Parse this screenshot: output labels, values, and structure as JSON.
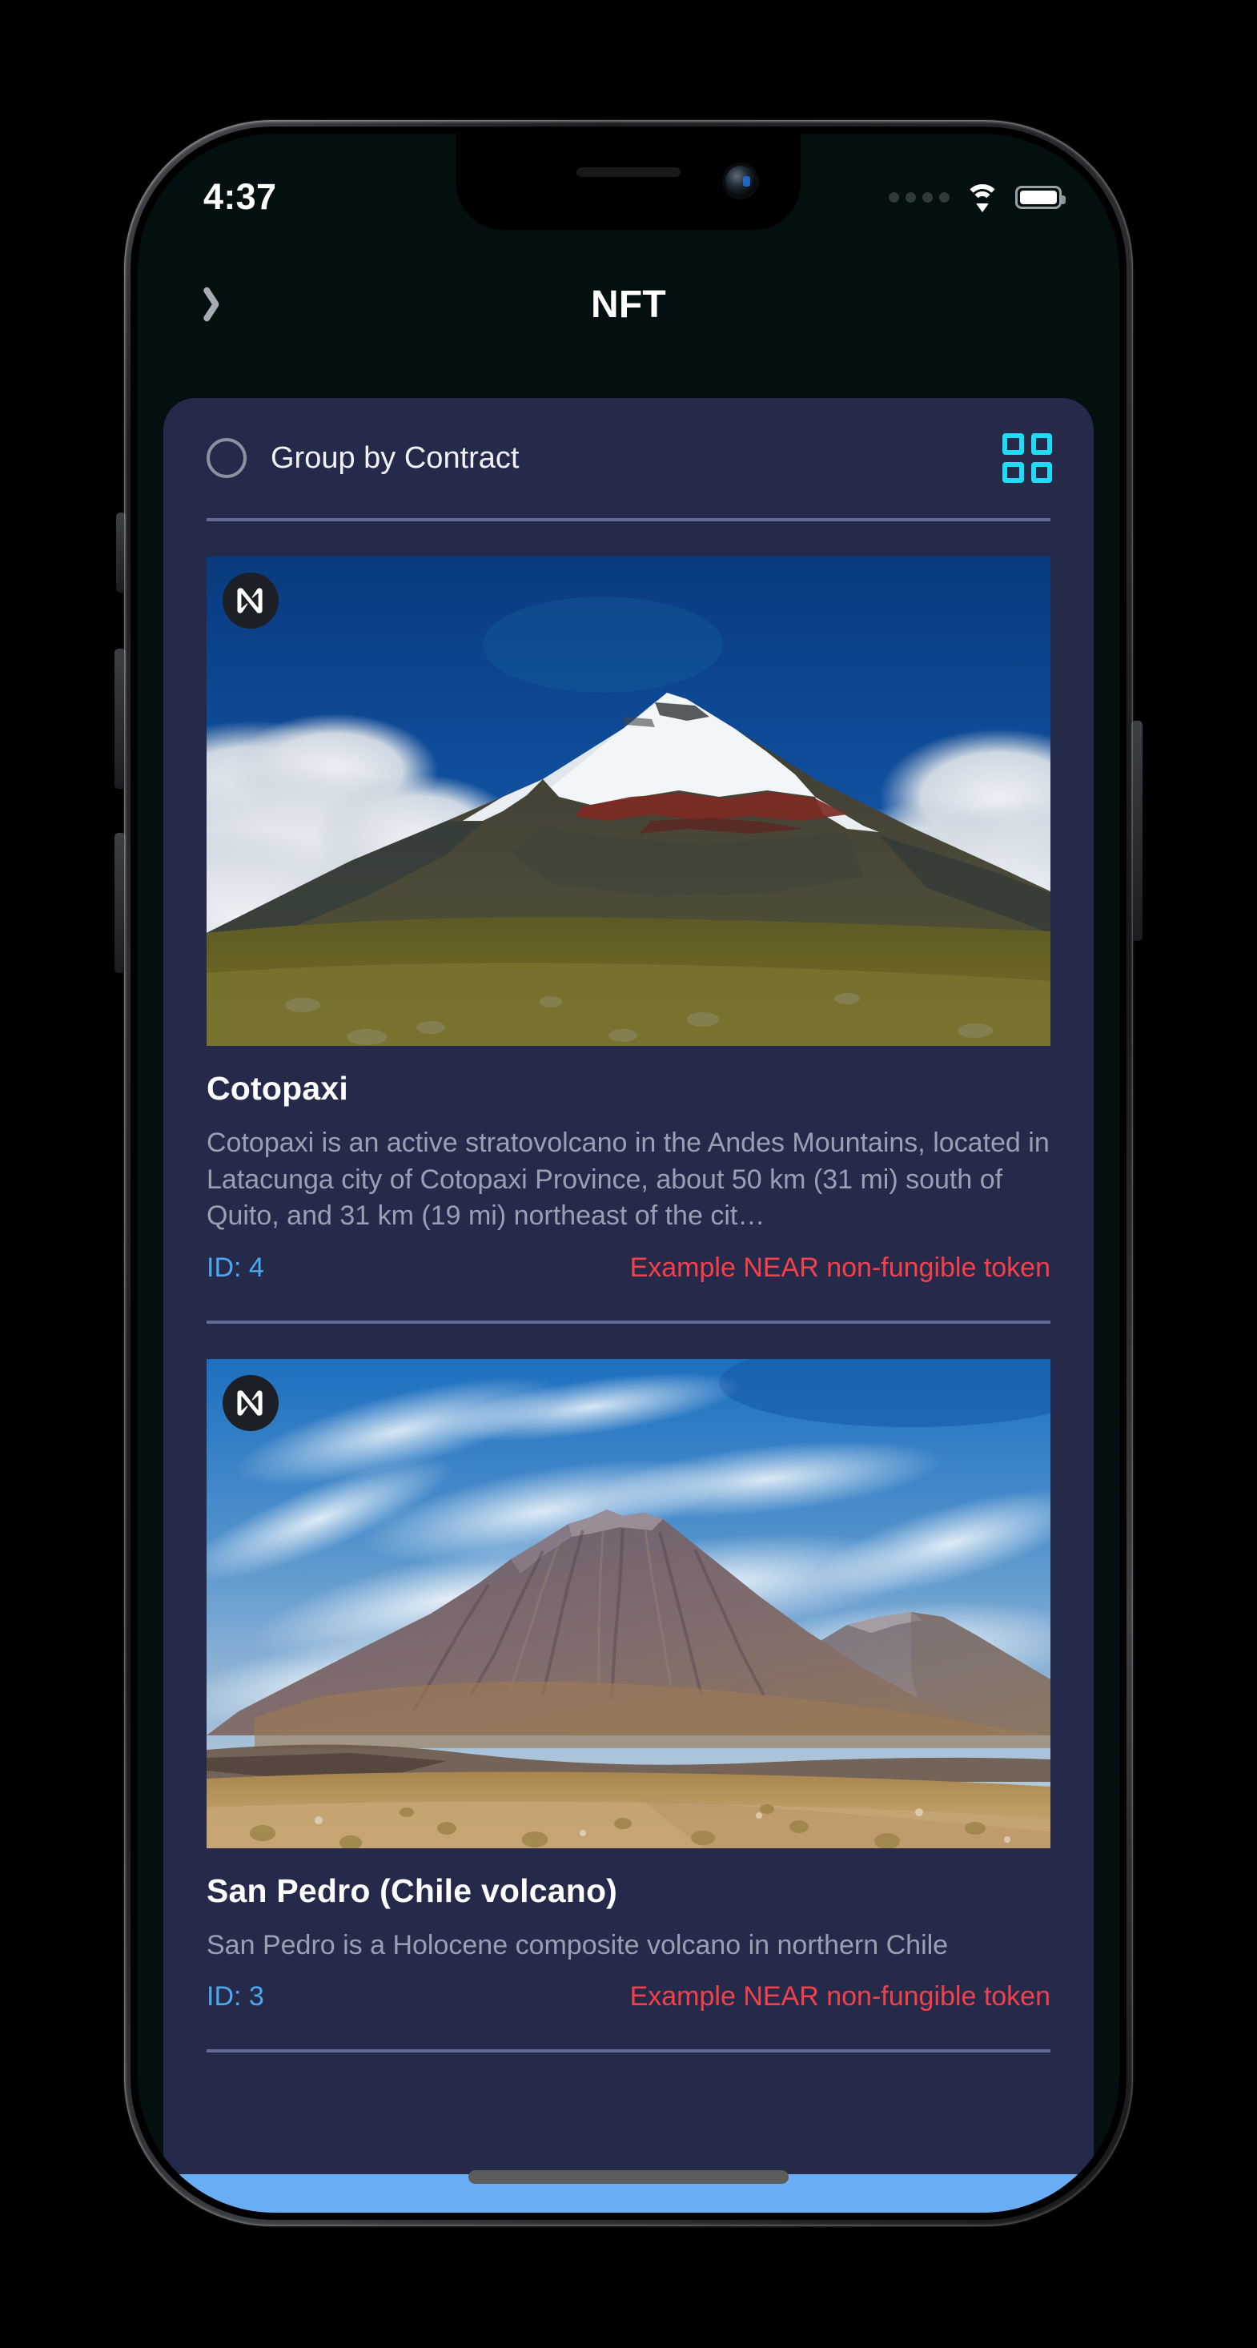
{
  "status_bar": {
    "time": "4:37",
    "signal_icon": "signal-dots-icon",
    "wifi_icon": "wifi-icon",
    "battery_icon": "battery-full-icon"
  },
  "nav": {
    "back_icon": "chevron-left-icon",
    "title": "NFT"
  },
  "toolbar": {
    "group_toggle_icon": "radio-unchecked-icon",
    "group_label": "Group by Contract",
    "grid_view_icon": "grid-view-icon"
  },
  "nft_items": [
    {
      "badge_icon": "near-logo-icon",
      "image_alt": "Cotopaxi volcano photograph",
      "title": "Cotopaxi",
      "description": "Cotopaxi is an active stratovolcano in the Andes Mountains, located in Latacunga city of Cotopaxi Province, about 50 km (31 mi) south of Quito, and 31 km (19 mi) northeast of the cit…",
      "id_label": "ID: 4",
      "contract_label": "Example NEAR non-fungible token"
    },
    {
      "badge_icon": "near-logo-icon",
      "image_alt": "San Pedro volcano photograph",
      "title": "San Pedro (Chile volcano)",
      "description": "San Pedro is a Holocene composite volcano in northern Chile",
      "id_label": "ID: 3",
      "contract_label": "Example NEAR non-fungible token"
    }
  ],
  "system": {
    "home_indicator": "home-indicator"
  },
  "colors": {
    "screen_bg": "#04100f",
    "panel_bg": "#252a4a",
    "accent_cyan": "#1fdcf5",
    "id_blue": "#4aa8f0",
    "contract_red": "#f5404a",
    "divider": "#6f76a8",
    "bottom_bar": "#69aef4"
  }
}
